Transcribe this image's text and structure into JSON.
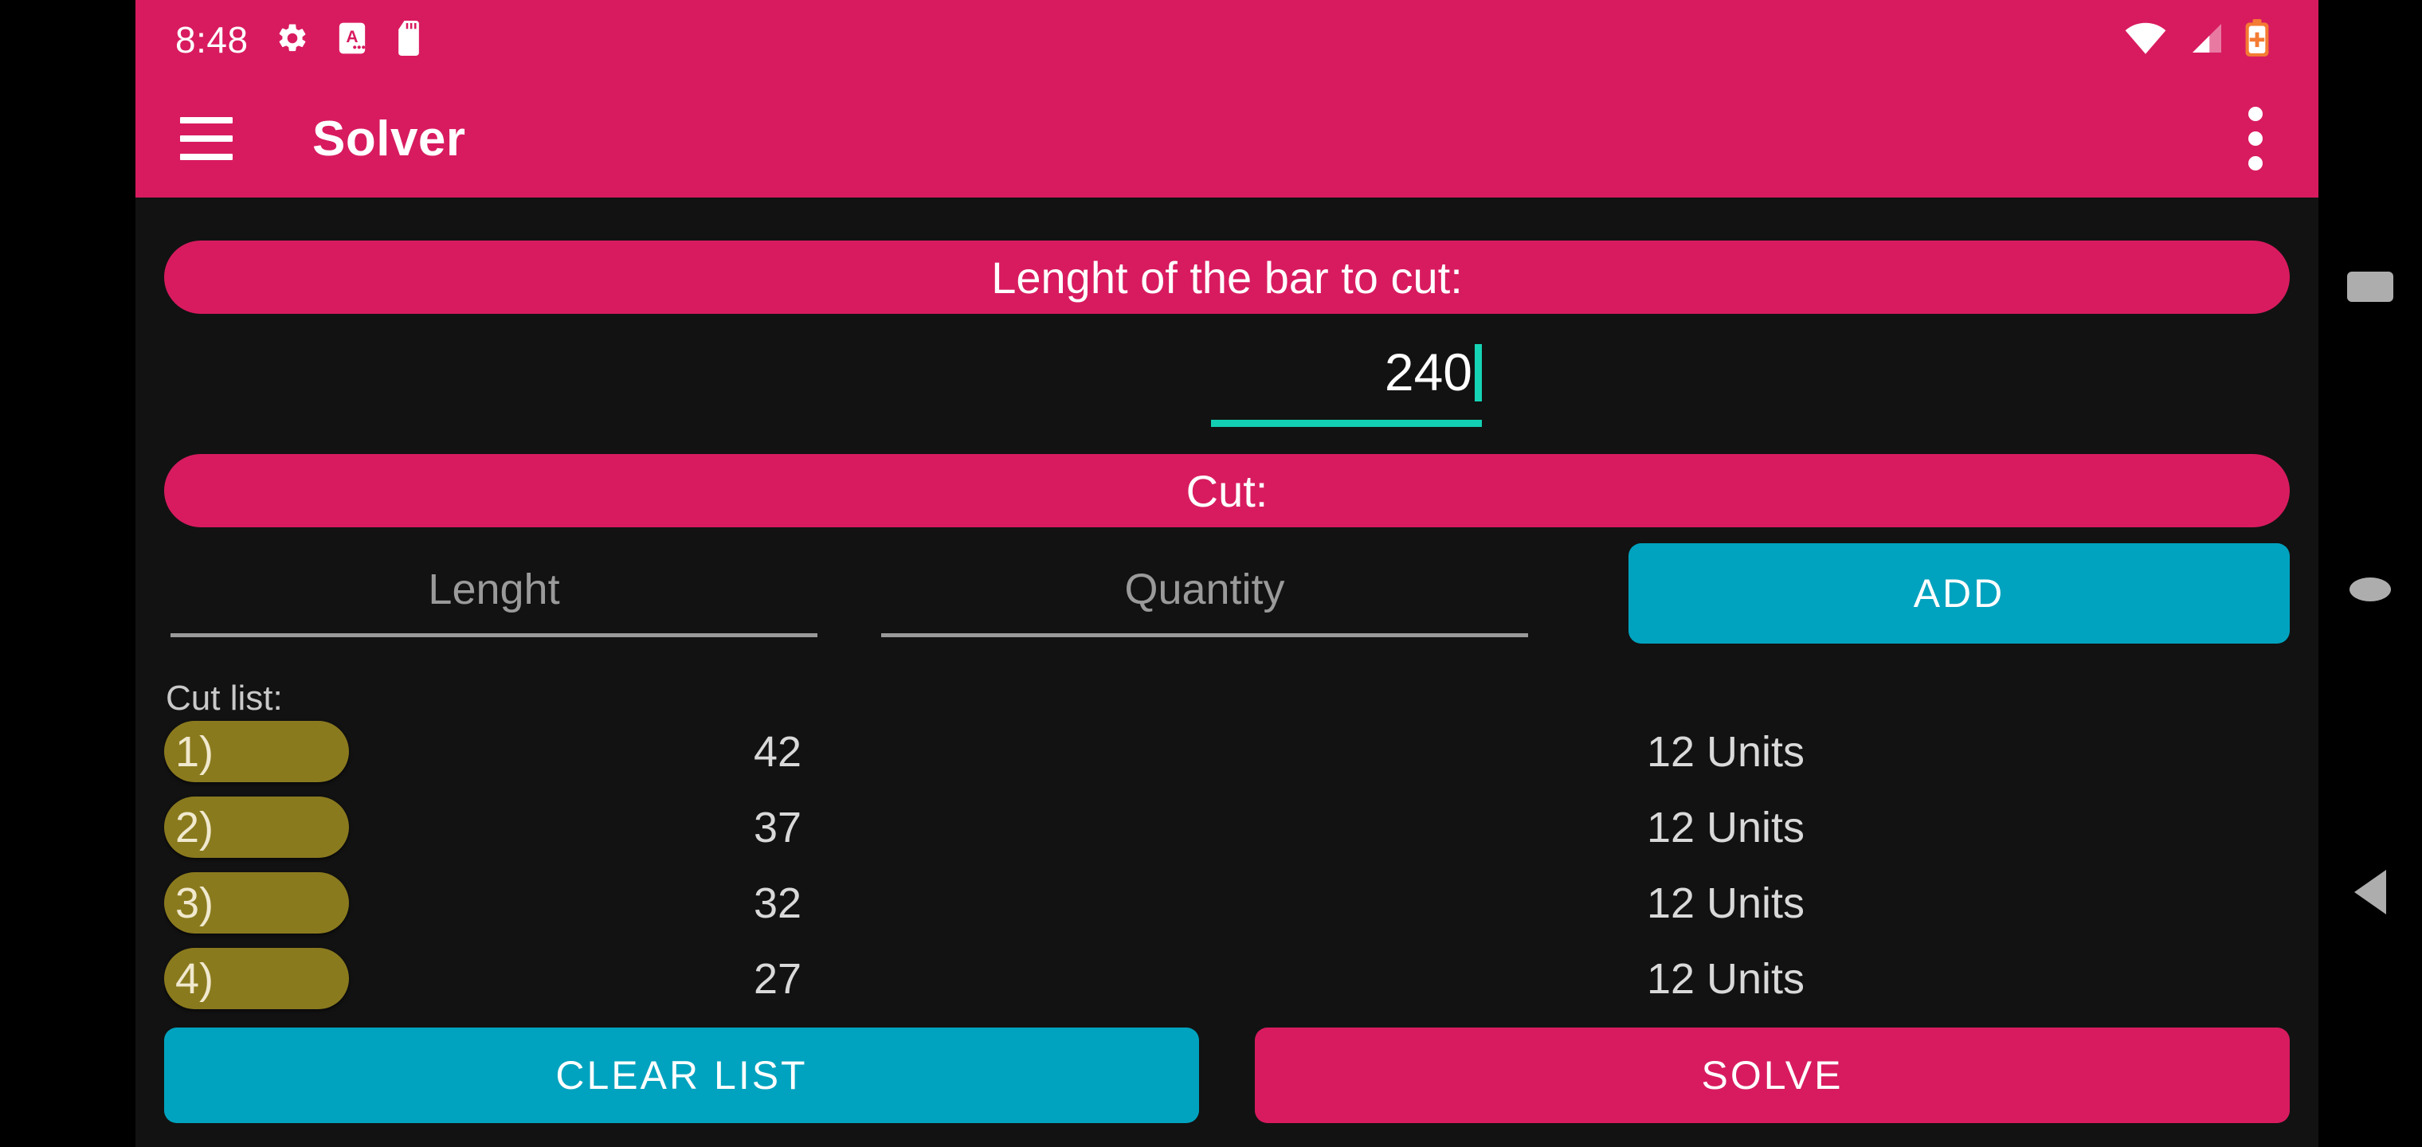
{
  "status_bar": {
    "time": "8:48",
    "icons_left": [
      "gear-icon",
      "a-font-icon",
      "sd-card-icon"
    ],
    "icons_right": [
      "wifi-icon",
      "signal-icon",
      "battery-saver-icon"
    ]
  },
  "app_bar": {
    "menu_icon": "hamburger-menu-icon",
    "title": "Solver",
    "overflow_icon": "overflow-menu-icon"
  },
  "banners": {
    "bar_length_label": "Lenght of the bar to cut:",
    "cut_label": "Cut:"
  },
  "bar_length_input": {
    "value": "240"
  },
  "cut_inputs": {
    "length_placeholder": "Lenght",
    "length_value": "",
    "quantity_placeholder": "Quantity",
    "quantity_value": "",
    "add_label": "ADD"
  },
  "cut_list": {
    "label": "Cut list:",
    "rows": [
      {
        "index": "1)",
        "length": "42",
        "quantity": "12 Units"
      },
      {
        "index": "2)",
        "length": "37",
        "quantity": "12 Units"
      },
      {
        "index": "3)",
        "length": "32",
        "quantity": "12 Units"
      },
      {
        "index": "4)",
        "length": "27",
        "quantity": "12 Units"
      }
    ]
  },
  "actions": {
    "clear_list_label": "CLEAR LIST",
    "solve_label": "SOLVE"
  },
  "navigation_bar": {
    "recents_icon": "square-recents-icon",
    "home_icon": "circle-home-icon",
    "back_icon": "triangle-back-icon"
  },
  "colors": {
    "primary_pink": "#D81B5F",
    "accent_cyan": "#00A3BF",
    "caret_teal": "#12CEB2",
    "list_pill_olive": "#8A7A1E",
    "background_dark": "#121212"
  }
}
